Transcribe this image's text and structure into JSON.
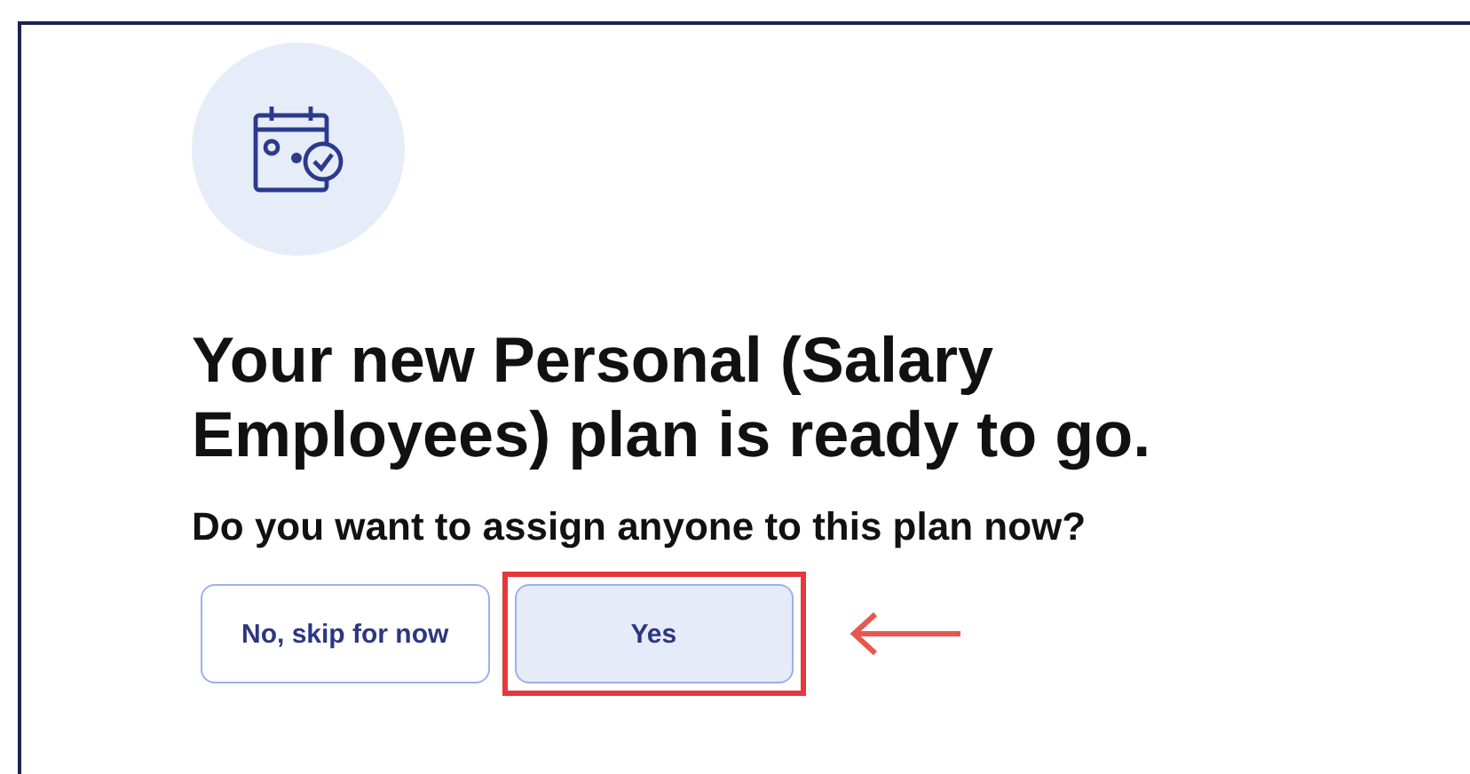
{
  "title": "Your new Personal (Salary Employees) plan is ready to go.",
  "question": "Do you want to assign anyone to this plan now?",
  "buttons": [
    {
      "label": "No, skip for now",
      "selected": false,
      "highlighted": false
    },
    {
      "label": "Yes",
      "selected": true,
      "highlighted": true
    }
  ]
}
